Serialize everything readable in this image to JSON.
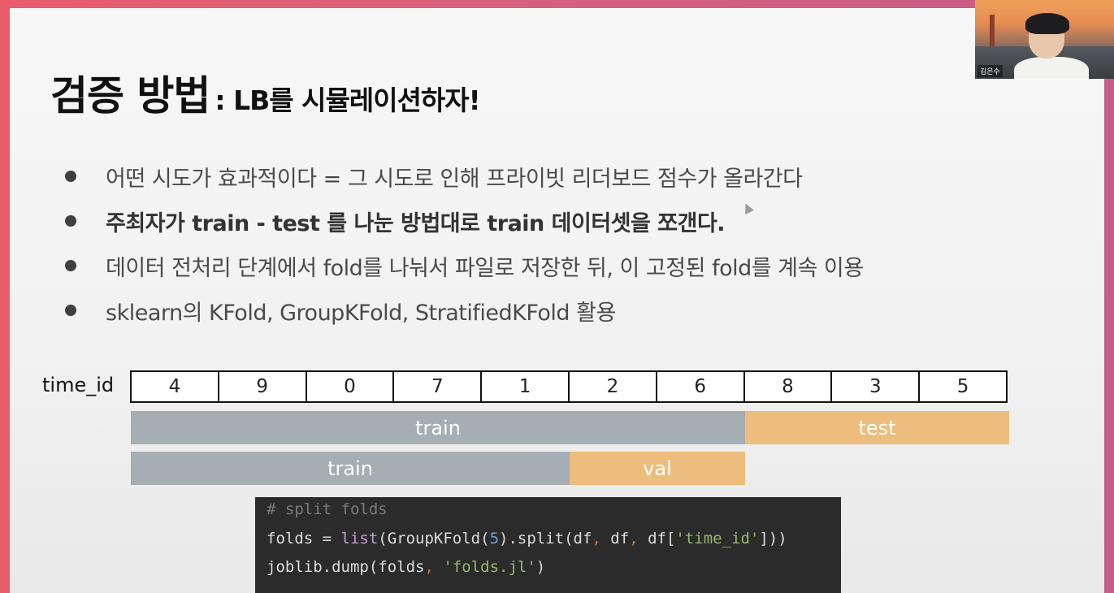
{
  "title": {
    "main": "검증 방법",
    "sub": ": LB를 시뮬레이션하자!"
  },
  "bullets": [
    {
      "text": "어떤 시도가 효과적이다 = 그 시도로 인해 프라이빗 리더보드 점수가 올라간다",
      "bold": false
    },
    {
      "text": "주최자가 train  -  test 를 나눈 방법대로 train 데이터셋을 쪼갠다.",
      "bold": true
    },
    {
      "text": "데이터 전처리 단계에서 fold를 나눠서 파일로 저장한 뒤, 이 고정된 fold를 계속 이용",
      "bold": false
    },
    {
      "text": "sklearn의 KFold, GroupKFold, StratifiedKFold 활용",
      "bold": false
    }
  ],
  "diagram": {
    "label": "time_id",
    "cells": [
      "4",
      "9",
      "0",
      "7",
      "1",
      "2",
      "6",
      "8",
      "3",
      "5"
    ],
    "row1": {
      "train": "train",
      "test": "test"
    },
    "row2": {
      "train": "train",
      "val": "val"
    }
  },
  "code": {
    "comment": "# split folds",
    "line2": {
      "a": "folds = ",
      "fn": "list",
      "b": "(GroupKFold(",
      "num": "5",
      "c": ").split(df",
      "d": " df",
      "e": " df[",
      "str": "'time_id'",
      "f": "]))"
    },
    "line3": {
      "a": "joblib.dump(folds",
      "str": "'folds.jl'",
      "b": ")"
    },
    "comma": ","
  },
  "video": {
    "name": "김은수"
  },
  "colors": {
    "gray_bar": "#a4aeb3",
    "orange_bar": "#edbd7d",
    "code_bg": "#2b2b2b"
  }
}
